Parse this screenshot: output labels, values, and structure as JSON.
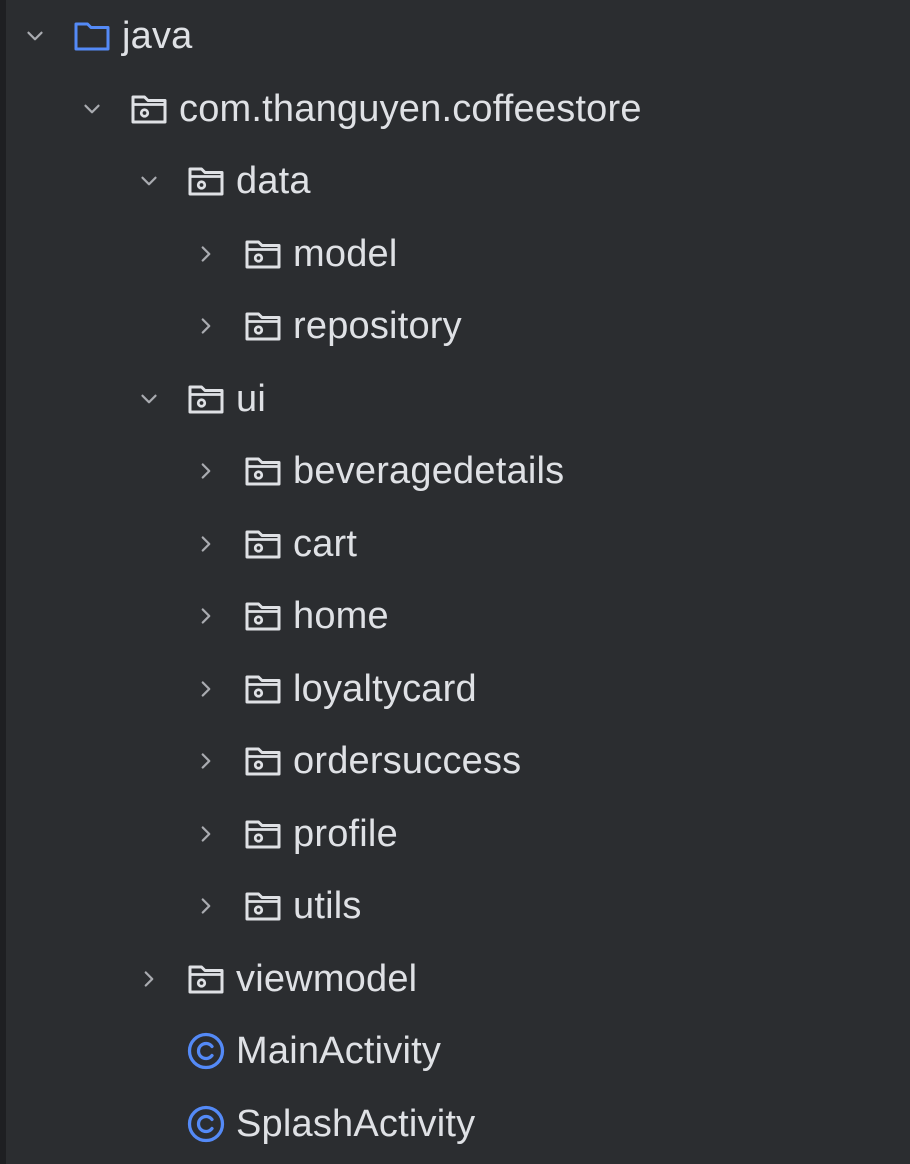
{
  "colors": {
    "background": "#2b2d30",
    "text": "#dfe1e5",
    "chevron": "#a9abb0",
    "folder_outline": "#dfe1e5",
    "source_root_folder": "#548af7",
    "class_icon": "#548af7"
  },
  "tree": {
    "items": [
      {
        "label": "java",
        "depth": 0,
        "expanded": true,
        "kind": "source-root-folder",
        "icon": "folder-icon"
      },
      {
        "label": "com.thanguyen.coffeestore",
        "depth": 1,
        "expanded": true,
        "kind": "package",
        "icon": "package-icon"
      },
      {
        "label": "data",
        "depth": 2,
        "expanded": true,
        "kind": "package",
        "icon": "package-icon"
      },
      {
        "label": "model",
        "depth": 3,
        "expanded": false,
        "kind": "package",
        "icon": "package-icon"
      },
      {
        "label": "repository",
        "depth": 3,
        "expanded": false,
        "kind": "package",
        "icon": "package-icon"
      },
      {
        "label": "ui",
        "depth": 2,
        "expanded": true,
        "kind": "package",
        "icon": "package-icon"
      },
      {
        "label": "beveragedetails",
        "depth": 3,
        "expanded": false,
        "kind": "package",
        "icon": "package-icon"
      },
      {
        "label": "cart",
        "depth": 3,
        "expanded": false,
        "kind": "package",
        "icon": "package-icon"
      },
      {
        "label": "home",
        "depth": 3,
        "expanded": false,
        "kind": "package",
        "icon": "package-icon"
      },
      {
        "label": "loyaltycard",
        "depth": 3,
        "expanded": false,
        "kind": "package",
        "icon": "package-icon"
      },
      {
        "label": "ordersuccess",
        "depth": 3,
        "expanded": false,
        "kind": "package",
        "icon": "package-icon"
      },
      {
        "label": "profile",
        "depth": 3,
        "expanded": false,
        "kind": "package",
        "icon": "package-icon"
      },
      {
        "label": "utils",
        "depth": 3,
        "expanded": false,
        "kind": "package",
        "icon": "package-icon"
      },
      {
        "label": "viewmodel",
        "depth": 2,
        "expanded": false,
        "kind": "package",
        "icon": "package-icon"
      },
      {
        "label": "MainActivity",
        "depth": 2,
        "kind": "class",
        "icon": "class-icon"
      },
      {
        "label": "SplashActivity",
        "depth": 2,
        "kind": "class",
        "icon": "class-icon"
      }
    ]
  }
}
